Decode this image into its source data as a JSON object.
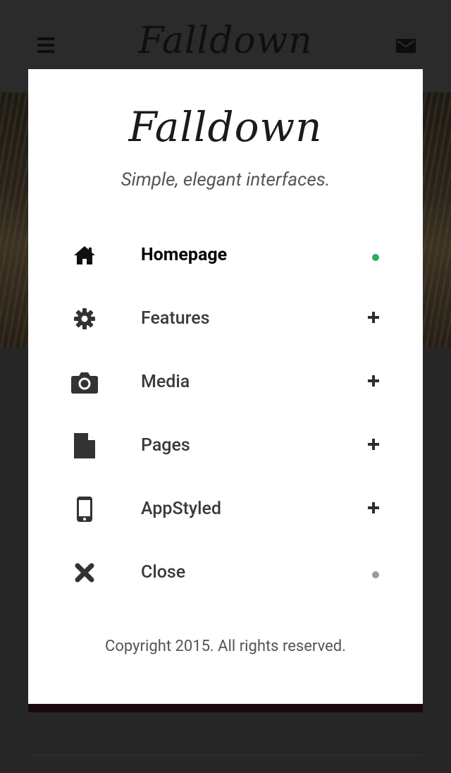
{
  "header": {
    "logo": "Falldown",
    "menu_icon": "hamburger-icon",
    "mail_icon": "envelope-icon"
  },
  "modal": {
    "logo": "Falldown",
    "tagline": "Simple, elegant interfaces.",
    "items": [
      {
        "label": "Homepage",
        "icon": "home-icon",
        "indicator": "dot",
        "indicator_color": "#27ae60",
        "active": true
      },
      {
        "label": "Features",
        "icon": "gear-icon",
        "indicator": "plus"
      },
      {
        "label": "Media",
        "icon": "camera-icon",
        "indicator": "plus"
      },
      {
        "label": "Pages",
        "icon": "file-icon",
        "indicator": "plus"
      },
      {
        "label": "AppStyled",
        "icon": "mobile-phone-icon",
        "indicator": "plus"
      },
      {
        "label": "Close",
        "icon": "close-icon",
        "indicator": "dot",
        "indicator_color": "#999999"
      }
    ],
    "copyright": "Copyright 2015. All rights reserved."
  },
  "colors": {
    "active_dot": "#27ae60",
    "inactive_dot": "#999999",
    "overlay": "#262626"
  }
}
